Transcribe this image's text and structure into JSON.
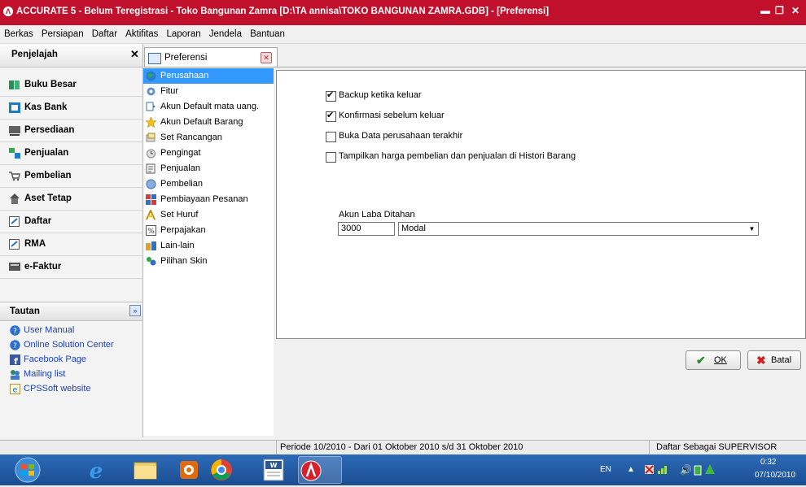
{
  "window": {
    "title": "ACCURATE 5 - Belum Teregistrasi - Toko Bangunan Zamra   [D:\\TA annisa\\TOKO BANGUNAN ZAMRA.GDB] - [Preferensi]",
    "minimize": "▬",
    "restore": "❐",
    "close": "✕"
  },
  "menu": [
    "Berkas",
    "Persiapan",
    "Daftar",
    "Aktifitas",
    "Laporan",
    "Jendela",
    "Bantuan"
  ],
  "explorer": {
    "title": "Penjelajah",
    "close": "✕",
    "items": [
      "Buku Besar",
      "Kas Bank",
      "Persediaan",
      "Penjualan",
      "Pembelian",
      "Aset Tetap",
      "Daftar",
      "RMA",
      "e-Faktur"
    ]
  },
  "links": {
    "title": "Tautan",
    "items": [
      "User Manual",
      "Online Solution Center",
      "Facebook Page",
      "Mailing list",
      "CPSSoft website"
    ]
  },
  "pref_tab": {
    "label": "Preferensi",
    "close": "✕"
  },
  "categories": [
    "Perusahaan",
    "Fitur",
    "Akun Default mata uang.",
    "Akun Default Barang",
    "Set Rancangan",
    "Pengingat",
    "Penjualan",
    "Pembelian",
    "Pembiayaan Pesanan",
    "Set Huruf",
    "Perpajakan",
    "Lain-lain",
    "Pilihan Skin"
  ],
  "selected_category": "Perusahaan",
  "options": [
    {
      "label": "Backup ketika keluar",
      "checked": true
    },
    {
      "label": "Konfirmasi sebelum keluar",
      "checked": true
    },
    {
      "label": "Buka Data perusahaan terakhir",
      "checked": false
    },
    {
      "label": "Tampilkan harga pembelian dan penjualan di Histori Barang",
      "checked": false
    }
  ],
  "akun_laba": {
    "label": "Akun Laba Ditahan",
    "code": "3000",
    "name": "Modal"
  },
  "buttons": {
    "ok": "OK",
    "cancel": "Batal"
  },
  "status": {
    "period": "Periode 10/2010 - Dari 01 Oktober 2010 s/d 31 Oktober 2010",
    "user": "Daftar Sebagai SUPERVISOR"
  },
  "taskbar": {
    "lang": "EN",
    "time": "0:32",
    "date": "07/10/2010"
  }
}
